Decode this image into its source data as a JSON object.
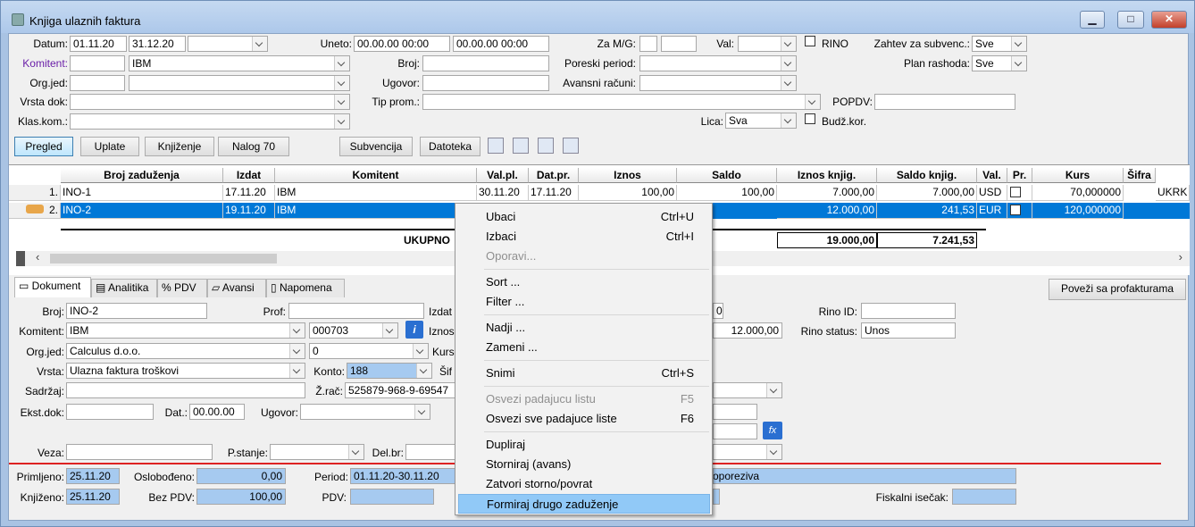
{
  "window": {
    "title": "Knjiga ulaznih faktura",
    "min": "▁",
    "max": "□",
    "close": "✕"
  },
  "filters": {
    "datum_label": "Datum:",
    "datum_from": "01.11.20",
    "datum_to": "31.12.20",
    "uneto_label": "Uneto:",
    "uneto_from": "00.00.00 00:00",
    "uneto_to": "00.00.00 00:00",
    "zamg_label": "Za M/G:",
    "val_label": "Val:",
    "rino_label": "RINO",
    "zahtev_label": "Zahtev za subvenc.:",
    "zahtev_value": "Sve",
    "komitent_label": "Komitent:",
    "komitent_value": "IBM",
    "broj_label": "Broj:",
    "poreski_label": "Poreski period:",
    "plan_label": "Plan rashoda:",
    "plan_value": "Sve",
    "orgjed_label": "Org.jed:",
    "ugovor_label": "Ugovor:",
    "avansni_label": "Avansni računi:",
    "vrstadok_label": "Vrsta dok:",
    "tipprom_label": "Tip prom.:",
    "popdv_label": "POPDV:",
    "klaskom_label": "Klas.kom.:",
    "lica_label": "Lica:",
    "lica_value": "Sva",
    "budz_label": "Budž.kor."
  },
  "toolbar": {
    "pregled": "Pregled",
    "uplate": "Uplate",
    "knjizenje": "Knjiženje",
    "nalog": "Nalog 70",
    "subvencija": "Subvencija",
    "datoteka": "Datoteka"
  },
  "grid": {
    "headers": [
      "Broj zaduženja",
      "Izdat",
      "Komitent",
      "Val.pl.",
      "Dat.pr.",
      "Iznos",
      "Saldo",
      "Iznos knjig.",
      "Saldo knjig.",
      "Val.",
      "Pr.",
      "Kurs",
      "Šifra"
    ],
    "rows": [
      {
        "n": "1.",
        "broj": "INO-1",
        "izdat": "17.11.20",
        "komitent": "IBM",
        "valpl": "30.11.20",
        "datpr": "17.11.20",
        "iznos": "100,00",
        "saldo": "100,00",
        "iznosk": "7.000,00",
        "saldok": "7.000,00",
        "val": "USD",
        "kurs": "70,000000",
        "sifra": "UKRK"
      },
      {
        "n": "2.",
        "broj": "INO-2",
        "izdat": "19.11.20",
        "komitent": "IBM",
        "iznosk": "12.000,00",
        "saldok": "241,53",
        "val": "EUR",
        "kurs": "120,000000"
      }
    ],
    "ukupno_label": "UKUPNO",
    "ukupno_iznos": "19.000,00",
    "ukupno_saldo": "7.241,53"
  },
  "tabs": [
    "Dokument",
    "Analitika",
    "PDV",
    "Avansi",
    "Napomena"
  ],
  "povezi": "Poveži sa profakturama",
  "doc": {
    "broj_label": "Broj:",
    "broj": "INO-2",
    "prof_label": "Prof:",
    "izdat_label": "Izdat",
    "rinoid_label": "Rino ID:",
    "rinostatus_label": "Rino status:",
    "rinostatus": "Unos",
    "komitent_label": "Komitent:",
    "komitent": "IBM",
    "komitent_code": "000703",
    "iznos_label": "Iznos",
    "iznos_val": "12.000,00",
    "orgjed_label": "Org.jed:",
    "orgjed": "Calculus d.o.o.",
    "orgjed_code": "0",
    "kurs_label": "Kurs",
    "vrsta_label": "Vrsta:",
    "vrsta": "Ulazna faktura troškovi",
    "konto_label": "Konto:",
    "konto": "188",
    "sifra_label": "Šif",
    "sadrzaj_label": "Sadržaj:",
    "zrac_label": "Ž.rač:",
    "zrac": "525879-968-9-69547",
    "ekst_label": "Ekst.dok:",
    "dat_label": "Dat.:",
    "dat": "00.00.00",
    "ugovor_label": "Ugovor:",
    "veza_label": "Veza:",
    "pstanje_label": "P.stanje:",
    "delbr_label": "Del.br:",
    "primljeno_label": "Primljeno:",
    "primljeno": "25.11.20",
    "oslobodjeno_label": "Oslobođeno:",
    "oslobodjeno": "0,00",
    "period_label": "Period:",
    "period": "01.11.20-30.11.20",
    "oporeziva": "oporeziva",
    "knjizeno_label": "Knjiženo:",
    "knjizeno": "25.11.20",
    "bezpdv_label": "Bez PDV:",
    "bezpdv": "100,00",
    "pdv_label": "PDV:",
    "fiskalni_label": "Fiskalni isečak:",
    "field0": "0"
  },
  "menu": {
    "ubaci": "Ubaci",
    "ubaci_s": "Ctrl+U",
    "izbaci": "Izbaci",
    "izbaci_s": "Ctrl+I",
    "oporavi": "Oporavi...",
    "sort": "Sort ...",
    "filter": "Filter ...",
    "nadji": "Nadji ...",
    "zameni": "Zameni ...",
    "snimi": "Snimi",
    "snimi_s": "Ctrl+S",
    "osvezi": "Osvezi padajucu listu",
    "osvezi_s": "F5",
    "osvezi_sve": "Osvezi sve padajuce liste",
    "osvezi_sve_s": "F6",
    "dupliraj": "Dupliraj",
    "storniraj": "Storniraj (avans)",
    "zatvori": "Zatvori storno/povrat",
    "formiraj": "Formiraj drugo zaduženje"
  }
}
